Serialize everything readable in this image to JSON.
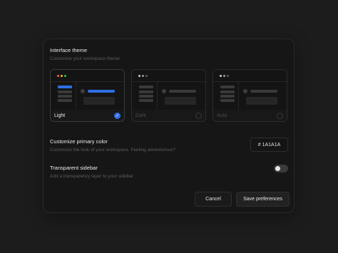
{
  "theme_section": {
    "title": "Interface theme",
    "subtitle": "Customise your workspace theme",
    "options": [
      {
        "label": "Light",
        "selected": true
      },
      {
        "label": "Dark",
        "selected": false
      },
      {
        "label": "Auto",
        "selected": false
      }
    ],
    "checkmark": "✓"
  },
  "primary_color": {
    "title": "Customize primary color",
    "subtitle": "Customize the look of your workspace. Feeling adventurous?",
    "value": "# 1A1A1A"
  },
  "transparent_sidebar": {
    "title": "Transparent sidebar",
    "subtitle": "Add a transparency layer to your sidebar",
    "enabled": false
  },
  "actions": {
    "cancel_label": "Cancel",
    "save_label": "Save preferences"
  },
  "colors": {
    "accent": "#2f6fe6",
    "background": "#1c1c1c",
    "panel": "#161616"
  }
}
